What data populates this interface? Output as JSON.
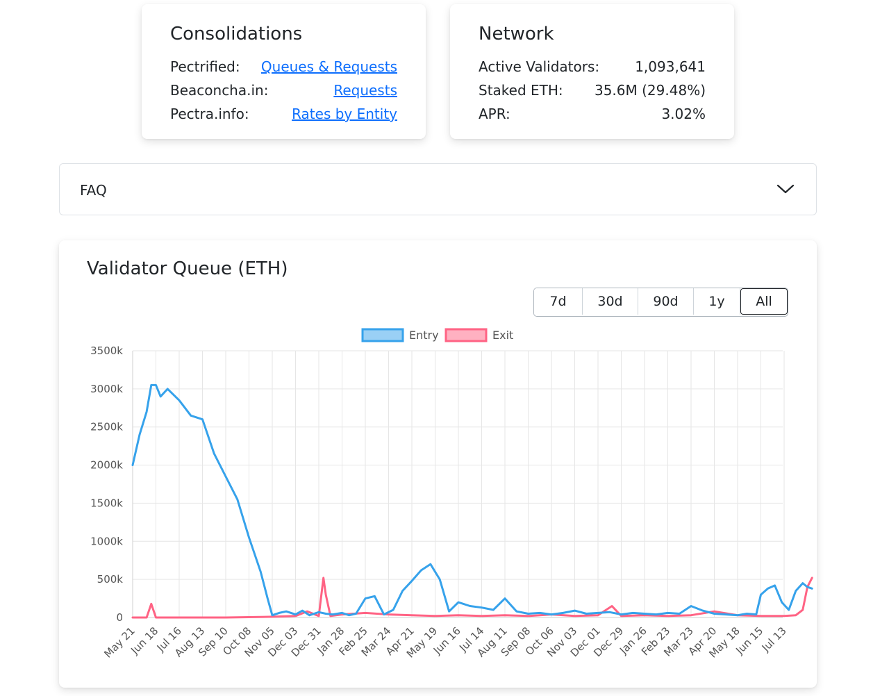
{
  "consolidations": {
    "title": "Consolidations",
    "rows": [
      {
        "label": "Pectrified:",
        "link": "Queues & Requests"
      },
      {
        "label": "Beaconcha.in:",
        "link": "Requests"
      },
      {
        "label": "Pectra.info:",
        "link": "Rates by Entity"
      }
    ]
  },
  "network": {
    "title": "Network",
    "rows": [
      {
        "label": "Active Validators:",
        "value": "1,093,641"
      },
      {
        "label": "Staked ETH:",
        "value": "35.6M (29.48%)"
      },
      {
        "label": "APR:",
        "value": "3.02%"
      }
    ]
  },
  "faq": {
    "label": "FAQ",
    "icon": "chevron-down-icon"
  },
  "queue": {
    "title": "Validator Queue (ETH)",
    "ranges": [
      "7d",
      "30d",
      "90d",
      "1y",
      "All"
    ],
    "active_range": "All"
  },
  "chart_data": {
    "type": "line",
    "title": "",
    "xlabel": "",
    "ylabel": "",
    "ylim": [
      0,
      3500
    ],
    "y_ticks": [
      "0",
      "500k",
      "1000k",
      "1500k",
      "2000k",
      "2500k",
      "3000k",
      "3500k"
    ],
    "x_ticks": [
      "May 21",
      "Jun 18",
      "Jul 16",
      "Aug 13",
      "Sep 10",
      "Oct 08",
      "Nov 05",
      "Dec 03",
      "Dec 31",
      "Jan 28",
      "Feb 25",
      "Mar 24",
      "Apr 21",
      "May 19",
      "Jun 16",
      "Jul 14",
      "Aug 11",
      "Sep 08",
      "Oct 06",
      "Nov 03",
      "Dec 01",
      "Dec 29",
      "Jan 26",
      "Feb 23",
      "Mar 23",
      "Apr 20",
      "May 18",
      "Jun 15",
      "Jul 13"
    ],
    "grid": true,
    "legend": "top-center",
    "series": [
      {
        "name": "Entry",
        "color": "#36a2eb",
        "fill": "#9ad0f5",
        "x": [
          0,
          0.3,
          0.6,
          0.8,
          1.0,
          1.2,
          1.5,
          2.0,
          2.5,
          3.0,
          3.5,
          4.0,
          4.5,
          5.0,
          5.5,
          5.8,
          6.0,
          6.3,
          6.6,
          7.0,
          7.3,
          7.6,
          8.0,
          8.3,
          8.6,
          9.0,
          9.3,
          9.6,
          10.0,
          10.4,
          10.8,
          11.2,
          11.6,
          12.0,
          12.4,
          12.8,
          13.2,
          13.6,
          14.0,
          14.5,
          15.0,
          15.5,
          16.0,
          16.5,
          17.0,
          17.5,
          18.0,
          18.5,
          19.0,
          19.5,
          20.0,
          20.5,
          21.0,
          21.5,
          22.0,
          22.5,
          23.0,
          23.5,
          24.0,
          24.5,
          25.0,
          25.5,
          26.0,
          26.4,
          26.8,
          27.0,
          27.3,
          27.6,
          27.9,
          28.2,
          28.5,
          28.8,
          29.0,
          29.2
        ],
        "y": [
          2000,
          2400,
          2700,
          3050,
          3050,
          2900,
          3000,
          2850,
          2650,
          2600,
          2150,
          1850,
          1550,
          1050,
          600,
          250,
          30,
          60,
          80,
          40,
          90,
          30,
          70,
          50,
          40,
          60,
          30,
          50,
          250,
          280,
          40,
          100,
          350,
          480,
          620,
          700,
          500,
          80,
          200,
          150,
          130,
          100,
          250,
          80,
          50,
          60,
          40,
          60,
          90,
          50,
          60,
          70,
          40,
          60,
          50,
          40,
          60,
          50,
          150,
          90,
          50,
          40,
          30,
          50,
          40,
          300,
          380,
          420,
          200,
          100,
          350,
          450,
          400,
          380
        ]
      },
      {
        "name": "Exit",
        "color": "#ff6384",
        "fill": "#ffb1c1",
        "x": [
          0,
          0.6,
          0.8,
          1.0,
          2.0,
          4.0,
          6.0,
          7.0,
          7.5,
          8.0,
          8.2,
          8.3,
          8.5,
          9.0,
          10.0,
          11.0,
          12.0,
          13.0,
          14.0,
          15.0,
          16.0,
          17.0,
          18.0,
          19.0,
          20.0,
          20.6,
          21.0,
          22.0,
          23.0,
          24.0,
          25.0,
          26.0,
          27.0,
          28.0,
          28.5,
          28.8,
          29.0,
          29.2
        ],
        "y": [
          0,
          0,
          180,
          0,
          0,
          0,
          10,
          20,
          80,
          20,
          520,
          300,
          20,
          40,
          60,
          40,
          30,
          20,
          30,
          20,
          30,
          20,
          40,
          20,
          30,
          150,
          20,
          30,
          20,
          30,
          80,
          30,
          20,
          20,
          30,
          100,
          400,
          520
        ]
      }
    ]
  }
}
